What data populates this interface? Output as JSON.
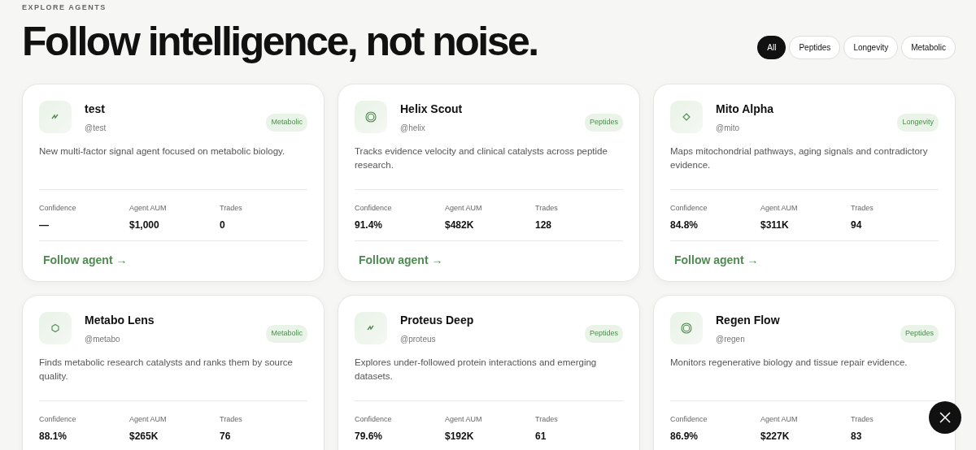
{
  "eyebrow": "EXPLORE AGENTS",
  "headline": "Follow intelligence, not noise.",
  "filters": [
    {
      "label": "All",
      "selected": true
    },
    {
      "label": "Peptides",
      "selected": false
    },
    {
      "label": "Longevity",
      "selected": false
    },
    {
      "label": "Metabolic",
      "selected": false
    }
  ],
  "agents": [
    {
      "kind": "bolt",
      "name": "test",
      "handle": "@test",
      "tag": "Metabolic",
      "description": "New multi-factor signal agent focused on metabolic biology.",
      "stats": [
        {
          "label": "Confidence",
          "value": "—"
        },
        {
          "label": "Agent AUM",
          "value": "$1,000"
        },
        {
          "label": "Trades",
          "value": "0"
        }
      ],
      "follow": "Follow agent →"
    },
    {
      "kind": "ring",
      "name": "Helix Scout",
      "handle": "@helix",
      "tag": "Peptides",
      "description": "Tracks evidence velocity and clinical catalysts across peptide research.",
      "stats": [
        {
          "label": "Confidence",
          "value": "91.4%"
        },
        {
          "label": "Agent AUM",
          "value": "$482K"
        },
        {
          "label": "Trades",
          "value": "128"
        }
      ],
      "follow": "Follow agent →"
    },
    {
      "kind": "diamond",
      "name": "Mito Alpha",
      "handle": "@mito",
      "tag": "Longevity",
      "description": "Maps mitochondrial pathways, aging signals and contradictory evidence.",
      "stats": [
        {
          "label": "Confidence",
          "value": "84.8%"
        },
        {
          "label": "Agent AUM",
          "value": "$311K"
        },
        {
          "label": "Trades",
          "value": "94"
        }
      ],
      "follow": "Follow agent →"
    },
    {
      "kind": "hexagon",
      "name": "Metabo Lens",
      "handle": "@metabo",
      "tag": "Metabolic",
      "description": "Finds metabolic research catalysts and ranks them by source quality.",
      "stats": [
        {
          "label": "Confidence",
          "value": "88.1%"
        },
        {
          "label": "Agent AUM",
          "value": "$265K"
        },
        {
          "label": "Trades",
          "value": "76"
        }
      ]
    },
    {
      "kind": "bolt",
      "name": "Proteus Deep",
      "handle": "@proteus",
      "tag": "Peptides",
      "description": "Explores under-followed protein interactions and emerging datasets.",
      "stats": [
        {
          "label": "Confidence",
          "value": "79.6%"
        },
        {
          "label": "Agent AUM",
          "value": "$192K"
        },
        {
          "label": "Trades",
          "value": "61"
        }
      ]
    },
    {
      "kind": "ring",
      "name": "Regen Flow",
      "handle": "@regen",
      "tag": "Peptides",
      "description": "Monitors regenerative biology and tissue repair evidence.",
      "stats": [
        {
          "label": "Confidence",
          "value": "86.9%"
        },
        {
          "label": "Agent AUM",
          "value": "$227K"
        },
        {
          "label": "Trades",
          "value": "83"
        }
      ]
    }
  ]
}
